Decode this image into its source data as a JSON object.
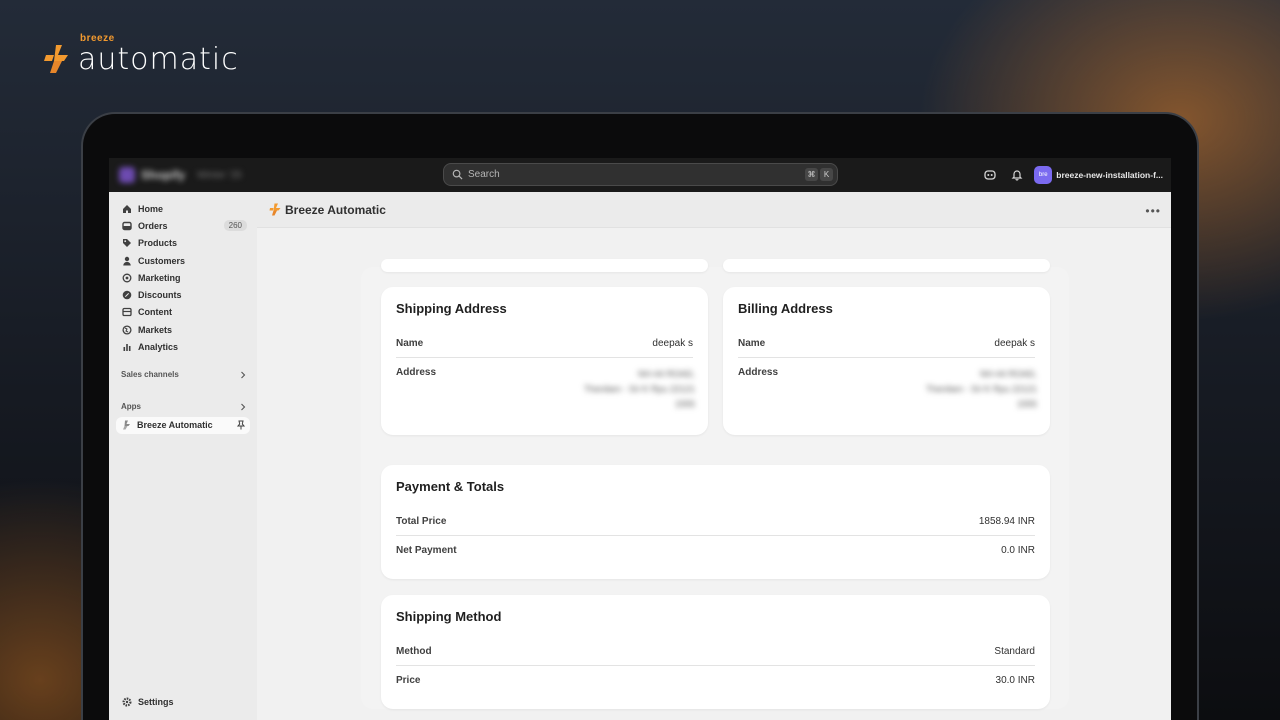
{
  "brand": {
    "small": "breeze",
    "big": "automatic"
  },
  "topbar": {
    "logo_text": "Shopify",
    "logo_sub": "Winter '25",
    "search_placeholder": "Search",
    "kbd1": "⌘",
    "kbd2": "K",
    "avatar": "bre",
    "store_name": "breeze-new-installation-f..."
  },
  "sidebar": {
    "items": [
      {
        "label": "Home",
        "icon": "home-icon"
      },
      {
        "label": "Orders",
        "icon": "orders-icon",
        "badge": "260"
      },
      {
        "label": "Products",
        "icon": "tag-icon"
      },
      {
        "label": "Customers",
        "icon": "person-icon"
      },
      {
        "label": "Marketing",
        "icon": "target-icon"
      },
      {
        "label": "Discounts",
        "icon": "discount-icon"
      },
      {
        "label": "Content",
        "icon": "content-icon"
      },
      {
        "label": "Markets",
        "icon": "globe-icon"
      },
      {
        "label": "Analytics",
        "icon": "bar-chart-icon"
      }
    ],
    "sales_channels": "Sales channels",
    "apps": "Apps",
    "app_item": "Breeze Automatic",
    "settings": "Settings"
  },
  "app_header": {
    "title": "Breeze Automatic"
  },
  "shipping_address": {
    "title": "Shipping Address",
    "name_label": "Name",
    "name_value": "deepak s",
    "address_label": "Address",
    "address_lines": [
      "NH-44 ROAD,",
      "Thenilam - Sri K Rpu 22121",
      "1555"
    ]
  },
  "billing_address": {
    "title": "Billing Address",
    "name_label": "Name",
    "name_value": "deepak s",
    "address_label": "Address",
    "address_lines": [
      "NH-44 ROAD,",
      "Thenilam - Sri K Rpu 22121",
      "1555"
    ]
  },
  "payment": {
    "title": "Payment & Totals",
    "total_label": "Total Price",
    "total_value": "1858.94 INR",
    "net_label": "Net Payment",
    "net_value": "0.0 INR"
  },
  "shipping_method": {
    "title": "Shipping Method",
    "method_label": "Method",
    "method_value": "Standard",
    "price_label": "Price",
    "price_value": "30.0 INR"
  },
  "colors": {
    "brand_orange": "#f39a2f",
    "avatar": "#7b6af0"
  }
}
